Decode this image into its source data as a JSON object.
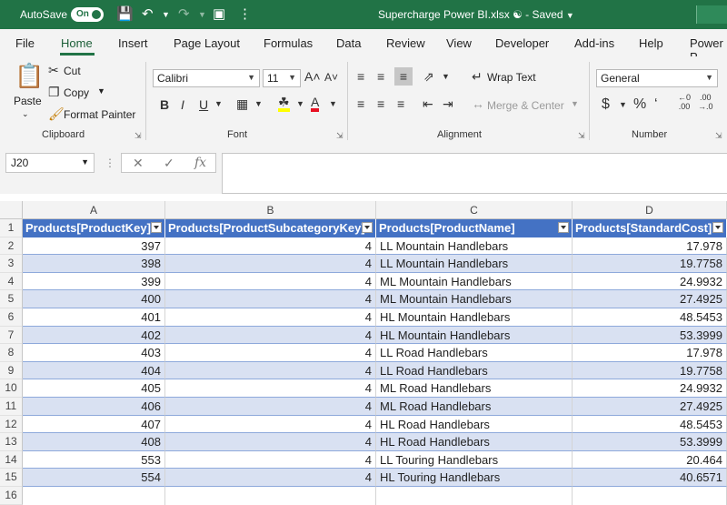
{
  "titlebar": {
    "autosave_label": "AutoSave",
    "autosave_state": "On",
    "document_title": "Supercharge Power BI.xlsx",
    "status": "Saved"
  },
  "tabs": [
    "File",
    "Home",
    "Insert",
    "Page Layout",
    "Formulas",
    "Data",
    "Review",
    "View",
    "Developer",
    "Add-ins",
    "Help",
    "Power P"
  ],
  "ribbon": {
    "clipboard": {
      "paste": "Paste",
      "cut": "Cut",
      "copy": "Copy",
      "format_painter": "Format Painter",
      "label": "Clipboard"
    },
    "font": {
      "name": "Calibri",
      "size": "11",
      "label": "Font"
    },
    "alignment": {
      "wrap_text": "Wrap Text",
      "merge_center": "Merge & Center",
      "label": "Alignment"
    },
    "number": {
      "format": "General",
      "label": "Number"
    }
  },
  "formula_bar": {
    "name_box": "J20",
    "formula": ""
  },
  "grid": {
    "columns": [
      "A",
      "B",
      "C",
      "D"
    ],
    "headers": [
      "Products[ProductKey]",
      "Products[ProductSubcategoryKey]",
      "Products[ProductName]",
      "Products[StandardCost]"
    ],
    "row_numbers": [
      "1",
      "2",
      "3",
      "4",
      "5",
      "6",
      "7",
      "8",
      "9",
      "10",
      "11",
      "12",
      "13",
      "14",
      "15",
      "16"
    ],
    "rows": [
      [
        "397",
        "4",
        "LL Mountain Handlebars",
        "17.978"
      ],
      [
        "398",
        "4",
        "LL Mountain Handlebars",
        "19.7758"
      ],
      [
        "399",
        "4",
        "ML Mountain Handlebars",
        "24.9932"
      ],
      [
        "400",
        "4",
        "ML Mountain Handlebars",
        "27.4925"
      ],
      [
        "401",
        "4",
        "HL Mountain Handlebars",
        "48.5453"
      ],
      [
        "402",
        "4",
        "HL Mountain Handlebars",
        "53.3999"
      ],
      [
        "403",
        "4",
        "LL Road Handlebars",
        "17.978"
      ],
      [
        "404",
        "4",
        "LL Road Handlebars",
        "19.7758"
      ],
      [
        "405",
        "4",
        "ML Road Handlebars",
        "24.9932"
      ],
      [
        "406",
        "4",
        "ML Road Handlebars",
        "27.4925"
      ],
      [
        "407",
        "4",
        "HL Road Handlebars",
        "48.5453"
      ],
      [
        "408",
        "4",
        "HL Road Handlebars",
        "53.3999"
      ],
      [
        "553",
        "4",
        "LL Touring Handlebars",
        "20.464"
      ],
      [
        "554",
        "4",
        "HL Touring Handlebars",
        "40.6571"
      ],
      [
        "",
        "",
        "",
        ""
      ]
    ]
  }
}
